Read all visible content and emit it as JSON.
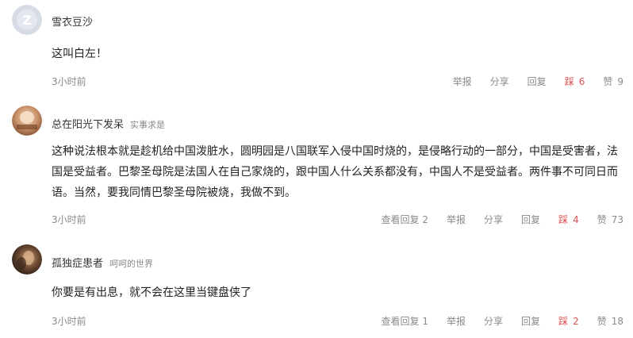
{
  "colors": {
    "dislike": "#e05151",
    "muted": "#8a8a8a"
  },
  "comments": [
    {
      "username": "雪衣豆沙",
      "signature": "",
      "text": "这叫白左！",
      "time": "3小时前",
      "replies_label": "",
      "report": "举报",
      "share": "分享",
      "reply": "回复",
      "dislike_label": "踩",
      "dislike_count": "6",
      "like_label": "赞",
      "like_count": "9",
      "avatar_icon": "default-avatar-icon"
    },
    {
      "username": "总在阳光下发呆",
      "signature": "实事求是",
      "text": "这种说法根本就是趁机给中国泼脏水，圆明园是八国联军入侵中国时烧的，是侵略行动的一部分，中国是受害者，法国是受益者。巴黎圣母院是法国人在自己家烧的，跟中国人什么关系都没有，中国人不是受益者。两件事不可同日而语。当然，要我同情巴黎圣母院被烧，我做不到。",
      "time": "3小时前",
      "replies_label": "查看回复 2",
      "report": "举报",
      "share": "分享",
      "reply": "回复",
      "dislike_label": "踩",
      "dislike_count": "4",
      "like_label": "赞",
      "like_count": "73",
      "avatar_icon": "user-photo-avatar"
    },
    {
      "username": "孤独症患者",
      "signature": "呵呵的世界",
      "text": "你要是有出息，就不会在这里当键盘侠了",
      "time": "3小时前",
      "replies_label": "查看回复 1",
      "report": "举报",
      "share": "分享",
      "reply": "回复",
      "dislike_label": "踩",
      "dislike_count": "2",
      "like_label": "赞",
      "like_count": "18",
      "avatar_icon": "user-photo-avatar"
    }
  ]
}
